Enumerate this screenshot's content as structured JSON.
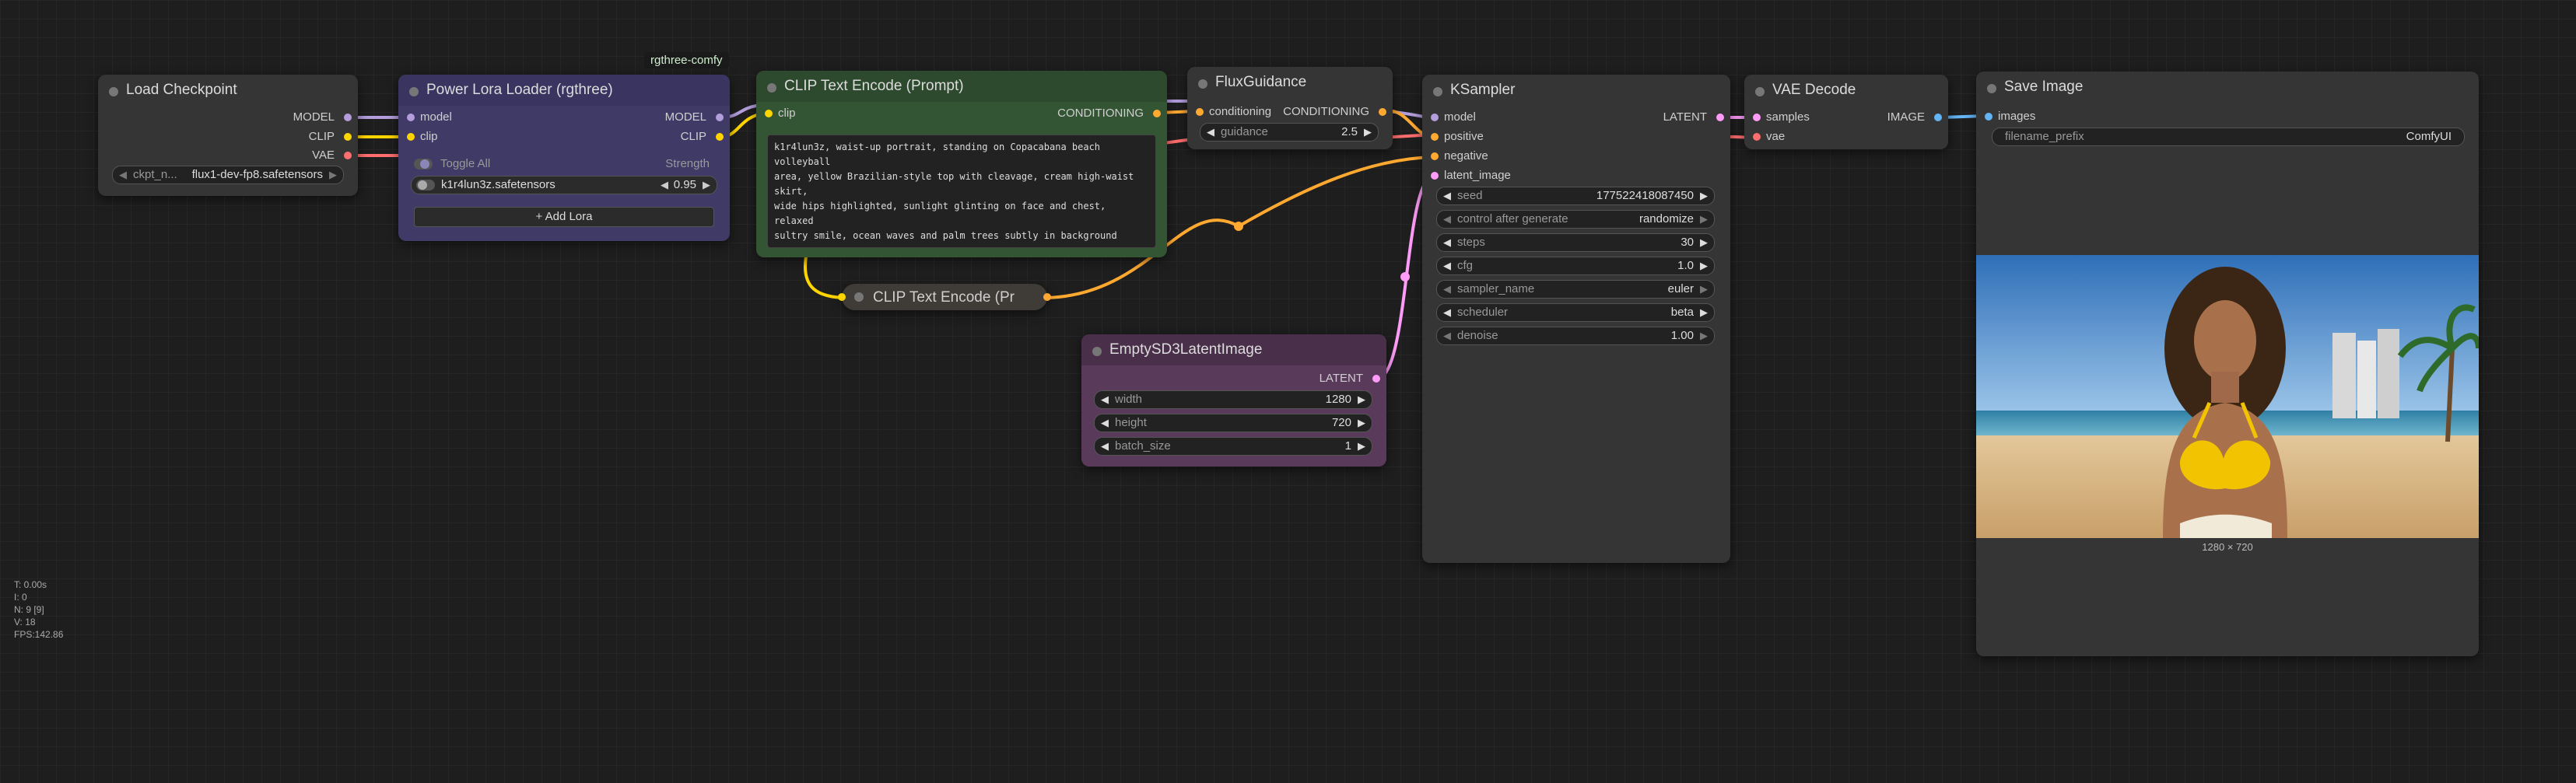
{
  "nodes": {
    "load_checkpoint": {
      "title": "Load Checkpoint",
      "outputs": [
        "MODEL",
        "CLIP",
        "VAE"
      ],
      "ckpt_label": "ckpt_n...",
      "ckpt_value": "flux1-dev-fp8.safetensors"
    },
    "power_lora": {
      "title": "Power Lora Loader (rgthree)",
      "badge": "rgthree-comfy",
      "inputs": [
        "model",
        "clip"
      ],
      "outputs": [
        "MODEL",
        "CLIP"
      ],
      "toggle_all": "Toggle All",
      "strength_header": "Strength",
      "lora_name": "k1r4lun3z.safetensors",
      "lora_strength": "0.95",
      "add_lora": "Add Lora"
    },
    "clip_text_encode": {
      "title": "CLIP Text Encode (Prompt)",
      "input": "clip",
      "output": "CONDITIONING",
      "text": "k1r4lun3z, waist-up portrait, standing on Copacabana beach volleyball\narea, yellow Brazilian-style top with cleavage, cream high-waist skirt,\nwide hips highlighted, sunlight glinting on face and chest, relaxed\nsultry smile, ocean waves and palm trees subtly in background"
    },
    "clip_text_encode_collapsed": {
      "title": "CLIP Text Encode (Pr"
    },
    "flux_guidance": {
      "title": "FluxGuidance",
      "input": "conditioning",
      "output": "CONDITIONING",
      "guidance_label": "guidance",
      "guidance_value": "2.5"
    },
    "empty_latent": {
      "title": "EmptySD3LatentImage",
      "output": "LATENT",
      "width_label": "width",
      "width_value": "1280",
      "height_label": "height",
      "height_value": "720",
      "batch_label": "batch_size",
      "batch_value": "1"
    },
    "ksampler": {
      "title": "KSampler",
      "inputs": [
        "model",
        "positive",
        "negative",
        "latent_image"
      ],
      "output": "LATENT",
      "widgets": [
        {
          "label": "seed",
          "value": "177522418087450"
        },
        {
          "label": "control after generate",
          "value": "randomize"
        },
        {
          "label": "steps",
          "value": "30"
        },
        {
          "label": "cfg",
          "value": "1.0"
        },
        {
          "label": "sampler_name",
          "value": "euler"
        },
        {
          "label": "scheduler",
          "value": "beta"
        },
        {
          "label": "denoise",
          "value": "1.00"
        }
      ]
    },
    "vae_decode": {
      "title": "VAE Decode",
      "inputs": [
        "samples",
        "vae"
      ],
      "output": "IMAGE"
    },
    "save_image": {
      "title": "Save Image",
      "input": "images",
      "prefix_label": "filename_prefix",
      "prefix_value": "ComfyUI",
      "image_size": "1280 × 720"
    }
  },
  "hud": {
    "t": "T: 0.00s",
    "i": "I: 0",
    "n": "N: 9 [9]",
    "v": "V: 18",
    "fps": "FPS:142.86"
  },
  "colors": {
    "model_link": "#b39ddb",
    "clip_link": "#ffd500",
    "vae_link": "#ff6e6e",
    "conditioning_link": "#ffa931",
    "latent_link": "#ff9cf9",
    "image_link": "#64b5f6"
  }
}
